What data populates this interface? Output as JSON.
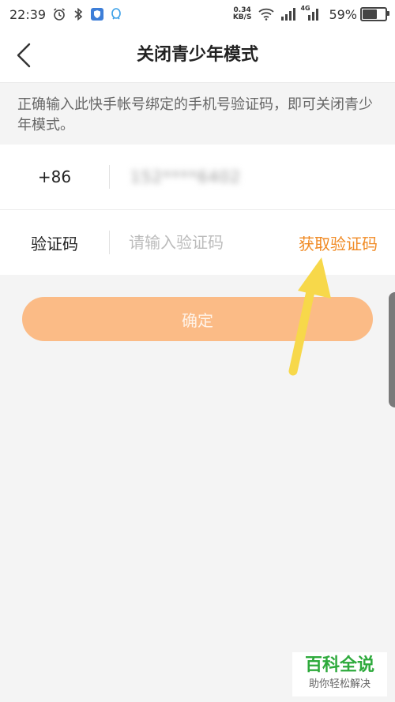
{
  "status_bar": {
    "time": "22:39",
    "net_speed_value": "0.34",
    "net_speed_unit": "KB/S",
    "network_label": "4G",
    "battery_percent": "59%",
    "battery_level": 0.59,
    "icons": [
      "alarm-icon",
      "bluetooth-icon",
      "shield-app-icon",
      "qq-icon",
      "wifi-icon",
      "signal-icon",
      "battery-icon"
    ]
  },
  "header": {
    "title": "关闭青少年模式",
    "back_icon": "chevron-left-icon"
  },
  "notice": {
    "text": "正确输入此快手帐号绑定的手机号验证码，即可关闭青少年模式。"
  },
  "form": {
    "phone": {
      "country_code": "+86",
      "masked_number": "152****6402"
    },
    "code": {
      "label": "验证码",
      "placeholder": "请输入验证码",
      "value": "",
      "get_code_label": "获取验证码"
    }
  },
  "confirm": {
    "label": "确定"
  },
  "colors": {
    "accent_orange": "#f08a24",
    "button_orange": "#fbbb86",
    "arrow_yellow": "#f7d84a",
    "watermark_green": "#2eaa3c",
    "background": "#f4f4f4"
  },
  "watermark": {
    "title": "百科全说",
    "subtitle": "助你轻松解决"
  }
}
